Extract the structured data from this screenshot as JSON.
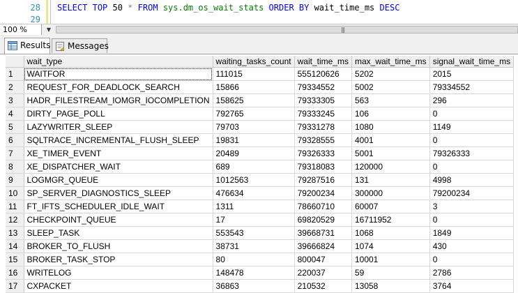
{
  "editor": {
    "lines": [
      {
        "number": "28",
        "sql": {
          "select": "SELECT",
          "top": "TOP",
          "count": "50",
          "star": "*",
          "from": "FROM",
          "source": "sys.dm_os_wait_stats",
          "order_by": "ORDER BY",
          "column": "wait_time_ms",
          "desc": "DESC"
        }
      },
      {
        "number": "29"
      }
    ]
  },
  "zoom": {
    "value": "100 %"
  },
  "tabs": [
    {
      "label": "Results",
      "icon": "grid-icon",
      "active": true
    },
    {
      "label": "Messages",
      "icon": "messages-icon",
      "active": false
    }
  ],
  "results": {
    "columns": [
      "wait_type",
      "waiting_tasks_count",
      "wait_time_ms",
      "max_wait_time_ms",
      "signal_wait_time_ms"
    ],
    "rows": [
      [
        "1",
        "WAITFOR",
        "111015",
        "555120626",
        "5202",
        "2015"
      ],
      [
        "2",
        "REQUEST_FOR_DEADLOCK_SEARCH",
        "15866",
        "79334552",
        "5002",
        "79334552"
      ],
      [
        "3",
        "HADR_FILESTREAM_IOMGR_IOCOMPLETION",
        "158625",
        "79333305",
        "563",
        "296"
      ],
      [
        "4",
        "DIRTY_PAGE_POLL",
        "792765",
        "79333245",
        "106",
        "0"
      ],
      [
        "5",
        "LAZYWRITER_SLEEP",
        "79703",
        "79331278",
        "1080",
        "1149"
      ],
      [
        "6",
        "SQLTRACE_INCREMENTAL_FLUSH_SLEEP",
        "19831",
        "79328555",
        "4001",
        "0"
      ],
      [
        "7",
        "XE_TIMER_EVENT",
        "20489",
        "79326333",
        "5001",
        "79326333"
      ],
      [
        "8",
        "XE_DISPATCHER_WAIT",
        "689",
        "79318083",
        "120000",
        "0"
      ],
      [
        "9",
        "LOGMGR_QUEUE",
        "1012563",
        "79287516",
        "131",
        "4998"
      ],
      [
        "10",
        "SP_SERVER_DIAGNOSTICS_SLEEP",
        "476634",
        "79200234",
        "300000",
        "79200234"
      ],
      [
        "11",
        "FT_IFTS_SCHEDULER_IDLE_WAIT",
        "1311",
        "78660710",
        "60007",
        "3"
      ],
      [
        "12",
        "CHECKPOINT_QUEUE",
        "17",
        "69820529",
        "16711952",
        "0"
      ],
      [
        "13",
        "SLEEP_TASK",
        "553543",
        "39668731",
        "1068",
        "1849"
      ],
      [
        "14",
        "BROKER_TO_FLUSH",
        "38731",
        "39666824",
        "1074",
        "430"
      ],
      [
        "15",
        "BROKER_TASK_STOP",
        "80",
        "800047",
        "10001",
        "0"
      ],
      [
        "16",
        "WRITELOG",
        "148478",
        "220037",
        "59",
        "2786"
      ],
      [
        "17",
        "CXPACKET",
        "36863",
        "210532",
        "13058",
        "3764"
      ]
    ]
  },
  "colors": {
    "keyword": "#0000ff",
    "object": "#008000",
    "line_number": "#2b91af",
    "gutter_change": "#f5e58a"
  }
}
